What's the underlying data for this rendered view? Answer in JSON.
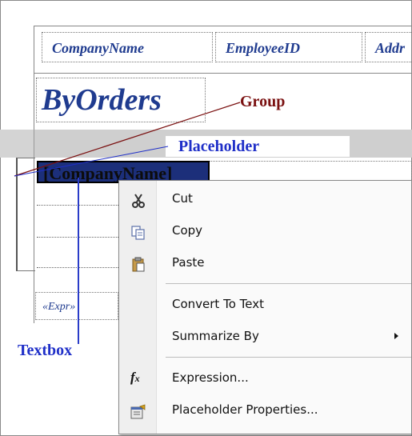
{
  "table_header": {
    "cells": [
      "CompanyName",
      "EmployeeID",
      "Addr"
    ]
  },
  "group_header": {
    "text": "ByOrders"
  },
  "annotations": {
    "group": "Group",
    "placeholder": "Placeholder",
    "textbox": "Textbox"
  },
  "selected_field": {
    "text": "[CompanyName]"
  },
  "footer_cell": {
    "text": "«Expr»"
  },
  "context_menu": {
    "cut": "Cut",
    "copy": "Copy",
    "paste": "Paste",
    "convert_to_text": "Convert To Text",
    "summarize_by": "Summarize By",
    "expression": "Expression...",
    "placeholder_properties": "Placeholder Properties..."
  },
  "colors": {
    "accent_blue": "#1f2fc8",
    "callout_red": "#7a1010",
    "selection": "#1c2f7a"
  }
}
